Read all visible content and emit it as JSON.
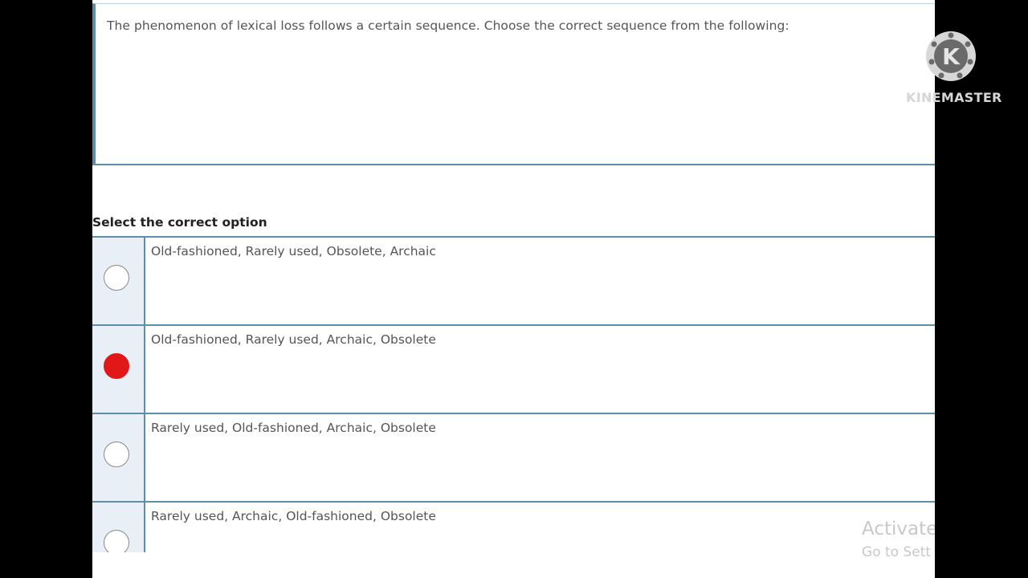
{
  "question": {
    "text": "The phenomenon of lexical loss follows a certain sequence. Choose the correct sequence from the following:"
  },
  "select_label": "Select the correct option",
  "options": [
    {
      "label": "Old-fashioned, Rarely used, Obsolete, Archaic",
      "selected": false
    },
    {
      "label": "Old-fashioned, Rarely used, Archaic, Obsolete",
      "selected": true
    },
    {
      "label": "Rarely used, Old-fashioned, Archaic, Obsolete",
      "selected": false
    },
    {
      "label": "Rarely used, Archaic, Old-fashioned, Obsolete",
      "selected": false
    }
  ],
  "watermark": {
    "line1": "Activate",
    "line2": "Go to Sett"
  },
  "overlay_logo": {
    "text": "KINEMASTER",
    "icon": "kinemaster-logo-icon"
  },
  "colors": {
    "accent_border": "#5f8fa8",
    "selected_radio": "#e21717",
    "radio_cell_bg": "#e8eff6"
  }
}
